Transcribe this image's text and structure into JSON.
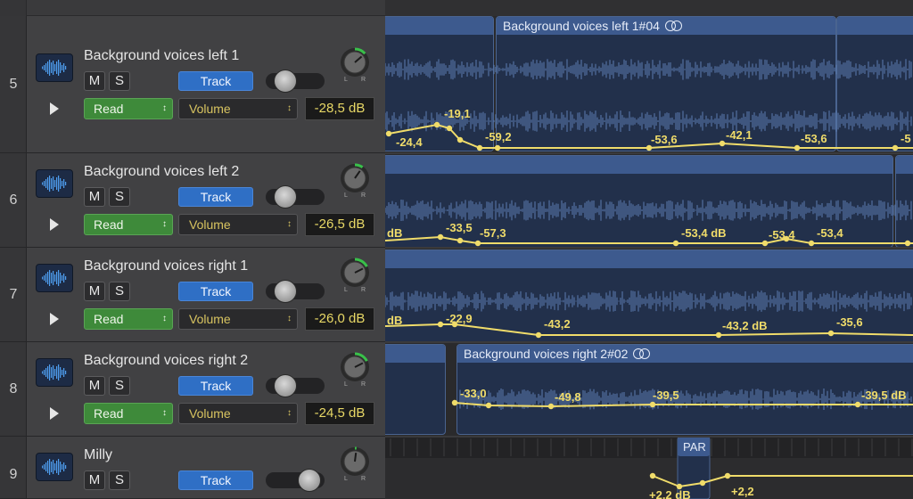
{
  "tracks": [
    {
      "number": "5",
      "name": "Background voices left 1",
      "mute_label": "M",
      "solo_label": "S",
      "track_label": "Track",
      "mode": "Read",
      "param": "Volume",
      "value": "-28,5 dB",
      "fader_level": 0.25,
      "pan": 0.35
    },
    {
      "number": "6",
      "name": "Background voices left 2",
      "mute_label": "M",
      "solo_label": "S",
      "track_label": "Track",
      "mode": "Read",
      "param": "Volume",
      "value": "-26,5 dB",
      "fader_level": 0.25,
      "pan": 0.25
    },
    {
      "number": "7",
      "name": "Background voices right 1",
      "mute_label": "M",
      "solo_label": "S",
      "track_label": "Track",
      "mode": "Read",
      "param": "Volume",
      "value": "-26,0 dB",
      "fader_level": 0.25,
      "pan": 0.45
    },
    {
      "number": "8",
      "name": "Background voices right 2",
      "mute_label": "M",
      "solo_label": "S",
      "track_label": "Track",
      "mode": "Read",
      "param": "Volume",
      "value": "-24,5 dB",
      "fader_level": 0.25,
      "pan": 0.45
    },
    {
      "number": "9",
      "name": "Milly",
      "mute_label": "M",
      "solo_label": "S",
      "track_label": "Track",
      "fader_level": 0.8,
      "pan": 0.05
    }
  ],
  "regions": {
    "lane5_title": "Background voices left 1#04",
    "lane8_title": "Background voices right 2#02",
    "lane9_title": "PAR"
  },
  "automation": {
    "lane5": [
      "-24,4",
      "-19,1",
      "-59,2",
      "-53,6",
      "-42,1",
      "-53,6",
      "-5"
    ],
    "lane6": [
      "dB",
      "-33,5",
      "-57,3",
      "-53,4 dB",
      "-53,4",
      "-53,4"
    ],
    "lane7": [
      "dB",
      "-22,9",
      "-43,2",
      "-43,2 dB",
      "-35,6"
    ],
    "lane8": [
      "-33,0",
      "-49,8",
      "-39,5",
      "-39,5 dB"
    ],
    "lane9": [
      "+2,2 dB",
      "+2,2"
    ]
  },
  "colors": {
    "track_button": "#2f6fc5",
    "read_button": "#3e8a3a",
    "automation_line": "#f0dc6a",
    "region_header": "#3d5a8e",
    "region_body": "#22304b",
    "pan_led": "#39c04a"
  }
}
